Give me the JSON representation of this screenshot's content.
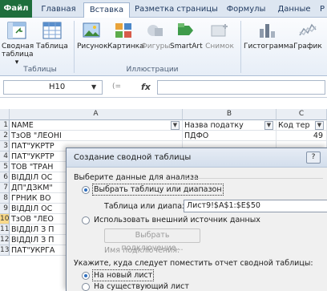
{
  "ribbon_tabs": [
    "Файл",
    "Главная",
    "Вставка",
    "Разметка страницы",
    "Формулы",
    "Данные",
    "Р"
  ],
  "ribbon": {
    "buttons": {
      "pivot": [
        "Сводная",
        "таблица ▾"
      ],
      "table": "Таблица",
      "picture": "Рисунок",
      "clipart": "Картинка",
      "shapes": "Фигуры",
      "smartart": "SmartArt",
      "screenshot": "Снимок",
      "histogram": "Гистограмма",
      "graph": "График"
    },
    "groups": {
      "tables": "Таблицы",
      "illustrations": "Иллюстрации"
    }
  },
  "formula_bar": {
    "name_box": "H10",
    "fx": "fx",
    "value": ""
  },
  "sheet": {
    "column_headers": [
      "A",
      "B",
      "C"
    ],
    "rows": [
      {
        "num": "1",
        "a": "NAME",
        "b": "Назва податку",
        "c": "Код тер"
      },
      {
        "num": "2",
        "a": "ТзОВ \"ЛЕОНІ",
        "b": "ПДФО",
        "c": "49"
      },
      {
        "num": "3",
        "a": "ПАТ\"УКРТР",
        "b": "",
        "c": ""
      },
      {
        "num": "4",
        "a": "ПАТ\"УКРТР",
        "b": "",
        "c": ""
      },
      {
        "num": "5",
        "a": "ТОВ \"ТРАН",
        "b": "",
        "c": ""
      },
      {
        "num": "6",
        "a": "ВІДДІЛ ОС",
        "b": "",
        "c": ""
      },
      {
        "num": "7",
        "a": "ДП\"ДЗКМ\"",
        "b": "",
        "c": ""
      },
      {
        "num": "8",
        "a": "ГРНИК ВО",
        "b": "",
        "c": ""
      },
      {
        "num": "9",
        "a": "ВІДДІЛ ОС",
        "b": "",
        "c": ""
      },
      {
        "num": "10",
        "a": "ТзОВ \"ЛЕО",
        "b": "",
        "c": ""
      },
      {
        "num": "11",
        "a": "ВІДДІЛ З П",
        "b": "",
        "c": ""
      },
      {
        "num": "12",
        "a": "ВІДДІЛ З П",
        "b": "",
        "c": ""
      },
      {
        "num": "13",
        "a": "ПАТ\"УКРГА",
        "b": "",
        "c": ""
      }
    ],
    "selected_row": "10"
  },
  "dialog": {
    "title": "Создание сводной таблицы",
    "help": "?",
    "section1": "Выберите данные для анализа",
    "opt_range": "Выбрать таблицу или диапазон",
    "range_label": "Таблица или диапазон:",
    "range_value": "Лист9!$A$1:$E$50",
    "opt_external": "Использовать внешний источник данных",
    "choose_connection": "Выбрать подключение...",
    "connection_name": "Имя подключения:",
    "section2": "Укажите, куда следует поместить отчет сводной таблицы:",
    "opt_new_sheet": "На новый лист",
    "opt_existing_sheet": "На существующий лист"
  }
}
